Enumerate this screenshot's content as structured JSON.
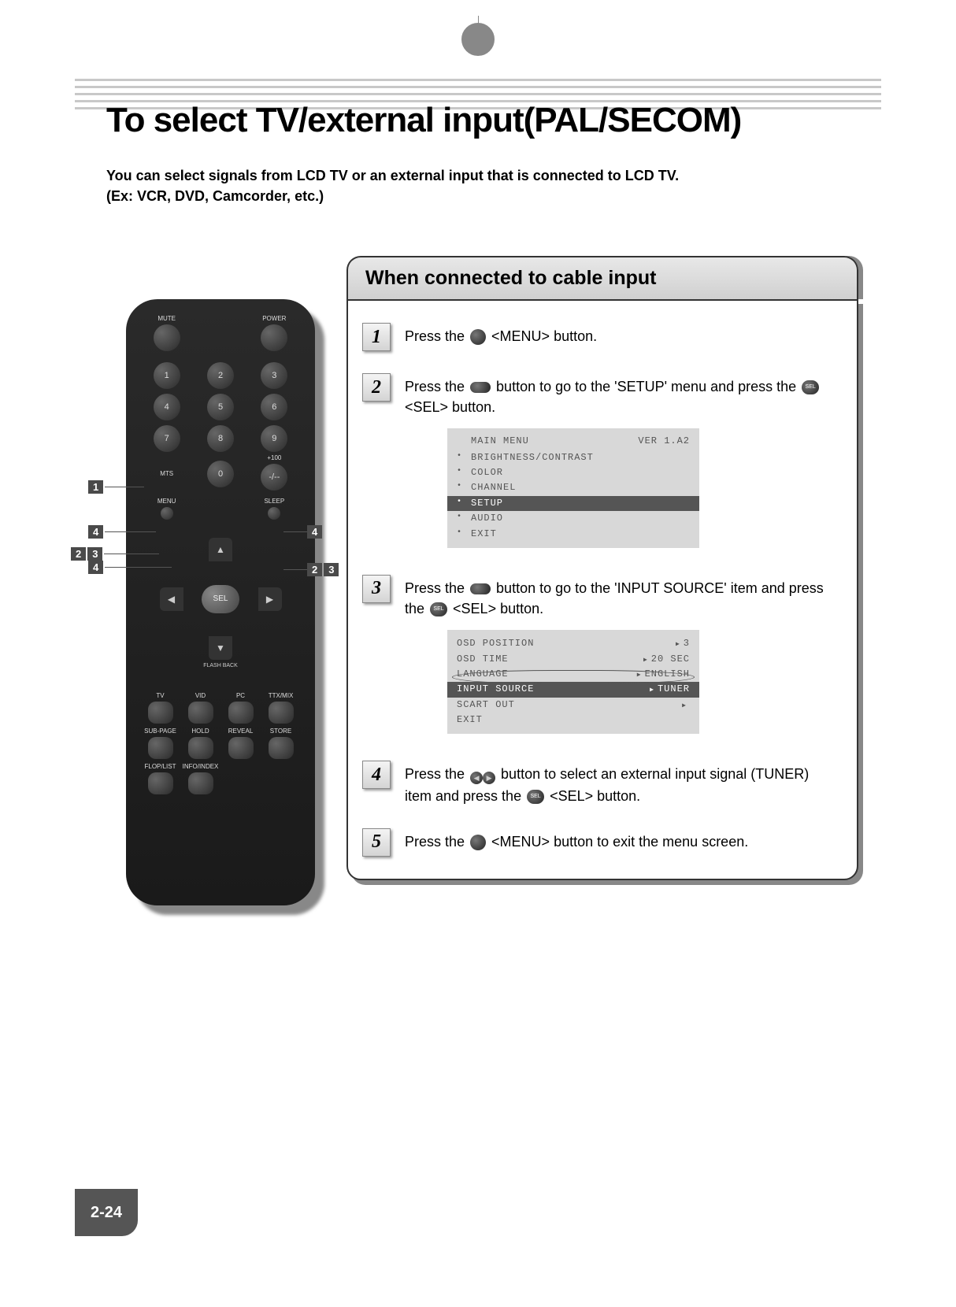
{
  "page": {
    "title": "To select TV/external input(PAL/SECOM)",
    "intro_line1": "You can select signals from LCD TV or an external input that is connected to LCD TV.",
    "intro_line2": "(Ex: VCR, DVD, Camcorder, etc.)",
    "page_number": "2-24"
  },
  "remote": {
    "top": {
      "mute": "MUTE",
      "power": "POWER"
    },
    "numbers": [
      "1",
      "2",
      "3",
      "4",
      "5",
      "6",
      "7",
      "8",
      "9",
      "0"
    ],
    "mts": "MTS",
    "plus100": "+100",
    "dashes": "-/--",
    "menu": "MENU",
    "sleep": "SLEEP",
    "sel": "SEL",
    "flash_back": "FLASH BACK",
    "row1": [
      "TV",
      "VID",
      "PC",
      "TTX/MIX"
    ],
    "row2": [
      "SUB-PAGE",
      "HOLD",
      "REVEAL",
      "STORE"
    ],
    "row3": [
      "FLOP/LIST",
      "INFO/INDEX"
    ]
  },
  "callouts": {
    "c1": "1",
    "c2": "2",
    "c3": "3",
    "c4": "4"
  },
  "panel": {
    "header": "When connected to cable input",
    "steps": {
      "s1": {
        "num": "1",
        "pre": "Press the ",
        "post": " <MENU> button."
      },
      "s2": {
        "num": "2",
        "pre": "Press the ",
        "mid": " button to go to the 'SETUP' menu and press the ",
        "post": " <SEL> button."
      },
      "s3": {
        "num": "3",
        "pre": "Press the ",
        "mid": " button to go to the 'INPUT SOURCE' item and press the ",
        "post": " <SEL> button."
      },
      "s4": {
        "num": "4",
        "pre": "Press the ",
        "mid": " button to select an external input signal (TUNER) item and press the ",
        "post": " <SEL> button."
      },
      "s5": {
        "num": "5",
        "pre": "Press the ",
        "post": " <MENU> button to exit the menu screen."
      }
    }
  },
  "osd1": {
    "title": "MAIN MENU",
    "version": "VER 1.A2",
    "items": [
      {
        "label": "BRIGHTNESS/CONTRAST",
        "hl": false
      },
      {
        "label": "COLOR",
        "hl": false
      },
      {
        "label": "CHANNEL",
        "hl": false
      },
      {
        "label": "SETUP",
        "hl": true
      },
      {
        "label": "AUDIO",
        "hl": false
      },
      {
        "label": "EXIT",
        "hl": false
      }
    ]
  },
  "osd2": {
    "items": [
      {
        "label": "OSD POSITION",
        "val": "3",
        "hl": false
      },
      {
        "label": "OSD TIME",
        "val": "20 SEC",
        "hl": false
      },
      {
        "label": "LANGUAGE",
        "val": "ENGLISH",
        "hl": false
      },
      {
        "label": "INPUT SOURCE",
        "val": "TUNER",
        "hl": true
      },
      {
        "label": "SCART OUT",
        "val": "",
        "hl": false
      },
      {
        "label": "EXIT",
        "val": "",
        "hl": false,
        "noarrow": true
      }
    ]
  }
}
